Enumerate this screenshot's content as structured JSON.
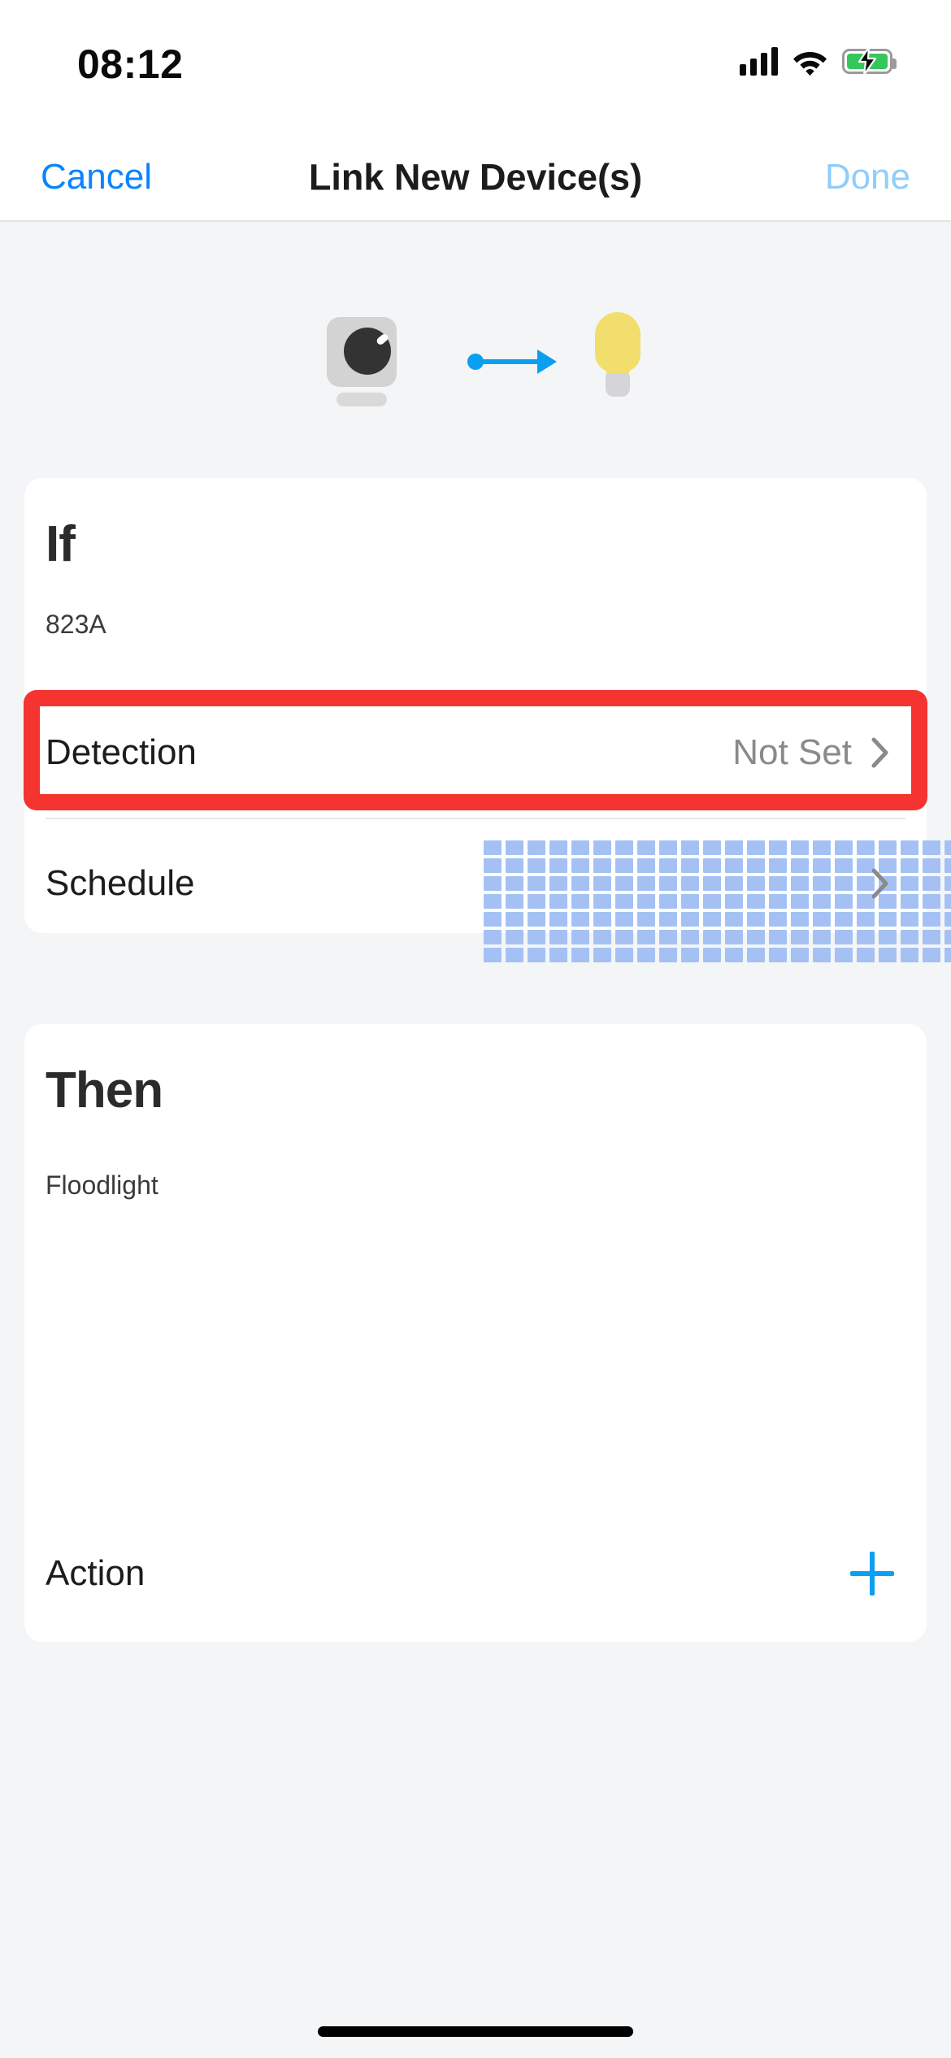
{
  "status_bar": {
    "time": "08:12",
    "cellular_icon": "cellular-signal-icon",
    "wifi_icon": "wifi-icon",
    "battery_icon": "battery-charging-icon",
    "battery_charging": true
  },
  "nav": {
    "cancel_label": "Cancel",
    "title": "Link New Device(s)",
    "done_label": "Done",
    "done_enabled": false
  },
  "link_graphic": {
    "source_icon": "camera-icon",
    "arrow_icon": "arrow-right-icon",
    "target_icon": "lightbulb-icon"
  },
  "if_section": {
    "heading": "If",
    "device_name": "823A",
    "rows": [
      {
        "label": "Detection",
        "value": "Not Set",
        "accessory": "chevron-right-icon",
        "highlighted": true
      },
      {
        "label": "Schedule",
        "value": "",
        "accessory": "chevron-right-icon",
        "highlighted": false
      }
    ],
    "schedule_grid": {
      "columns": 24,
      "rows": 7,
      "cell_color": "#A5C1F4",
      "all_selected": true
    }
  },
  "then_section": {
    "heading": "Then",
    "device_name": "Floodlight",
    "rows": [
      {
        "label": "Action",
        "value": "",
        "accessory": "plus-icon",
        "highlighted": false
      }
    ]
  },
  "annotation": {
    "type": "highlight-box",
    "color": "#F5332F",
    "target": "Detection"
  },
  "colors": {
    "accent_blue": "#0A84FF",
    "icon_blue": "#0A9FF0",
    "disabled_blue": "#8FCDFB",
    "background": "#F4F5F7",
    "card": "#FFFFFF",
    "secondary_text": "#8A8A8E",
    "battery_green": "#34C759",
    "bulb_yellow": "#F2DE6D",
    "highlight_red": "#F5332F"
  }
}
